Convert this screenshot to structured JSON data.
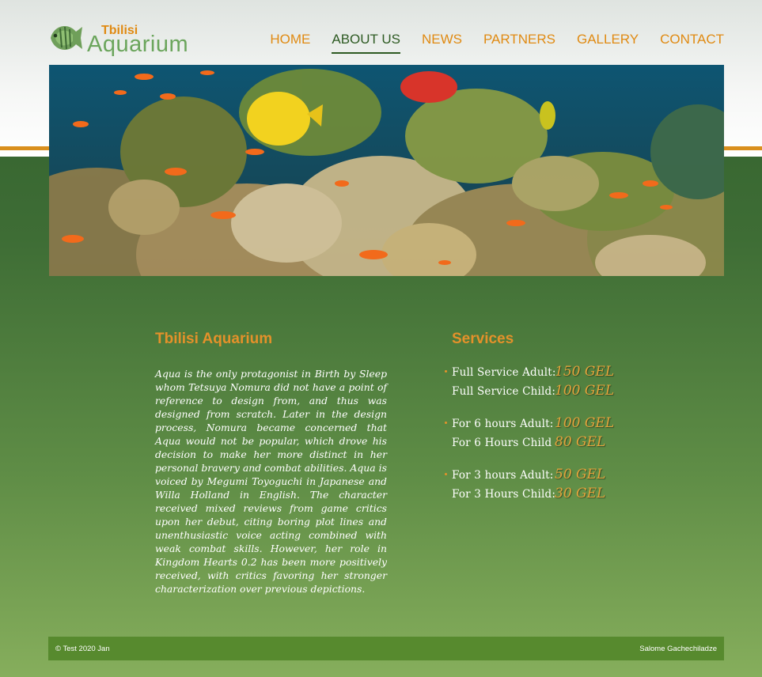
{
  "brand": {
    "small": "Tbilisi",
    "big": "Aquarium",
    "logo_icon": "fish-icon"
  },
  "nav": [
    {
      "label": "HOME",
      "active": false
    },
    {
      "label": "ABOUT US",
      "active": true
    },
    {
      "label": "NEWS",
      "active": false
    },
    {
      "label": "PARTNERS",
      "active": false
    },
    {
      "label": "GALLERY",
      "active": false
    },
    {
      "label": "CONTACT",
      "active": false
    }
  ],
  "about": {
    "title": "Tbilisi Aquarium",
    "body": "Aqua is the only protagonist in Birth by Sleep whom Tetsuya Nomura did not have a point of reference to design from, and thus was designed from scratch. Later in the design process, Nomura became concerned that Aqua would not be popular, which drove his decision to make her more distinct in her personal bravery and combat abilities. Aqua is voiced by Megumi Toyoguchi in Japanese and Willa Holland in English. The character received mixed reviews from game critics upon her debut, citing boring plot lines and unenthusiastic voice acting combined with weak combat skills. However, her role in Kingdom Hearts 0.2 has been more positively received, with critics favoring her stronger characterization over previous depictions."
  },
  "services": {
    "title": "Services",
    "groups": [
      [
        {
          "label": "Full Service Adult:",
          "price": "150 GEL"
        },
        {
          "label": "Full Service Child:",
          "price": "100 GEL"
        }
      ],
      [
        {
          "label": "For 6 hours Adult:",
          "price": "100 GEL"
        },
        {
          "label": "For 6 Hours Child",
          "price": "80 GEL"
        }
      ],
      [
        {
          "label": "For 3 hours Adult:",
          "price": "50 GEL"
        },
        {
          "label": "For 3 Hours Child:",
          "price": "30 GEL"
        }
      ]
    ]
  },
  "footer": {
    "left": "© Test 2020 Jan",
    "right": "Salome Gachechiladze"
  },
  "colors": {
    "accent": "#e08a12",
    "dark_green": "#2d5a22",
    "footer_green": "#578a2e"
  }
}
